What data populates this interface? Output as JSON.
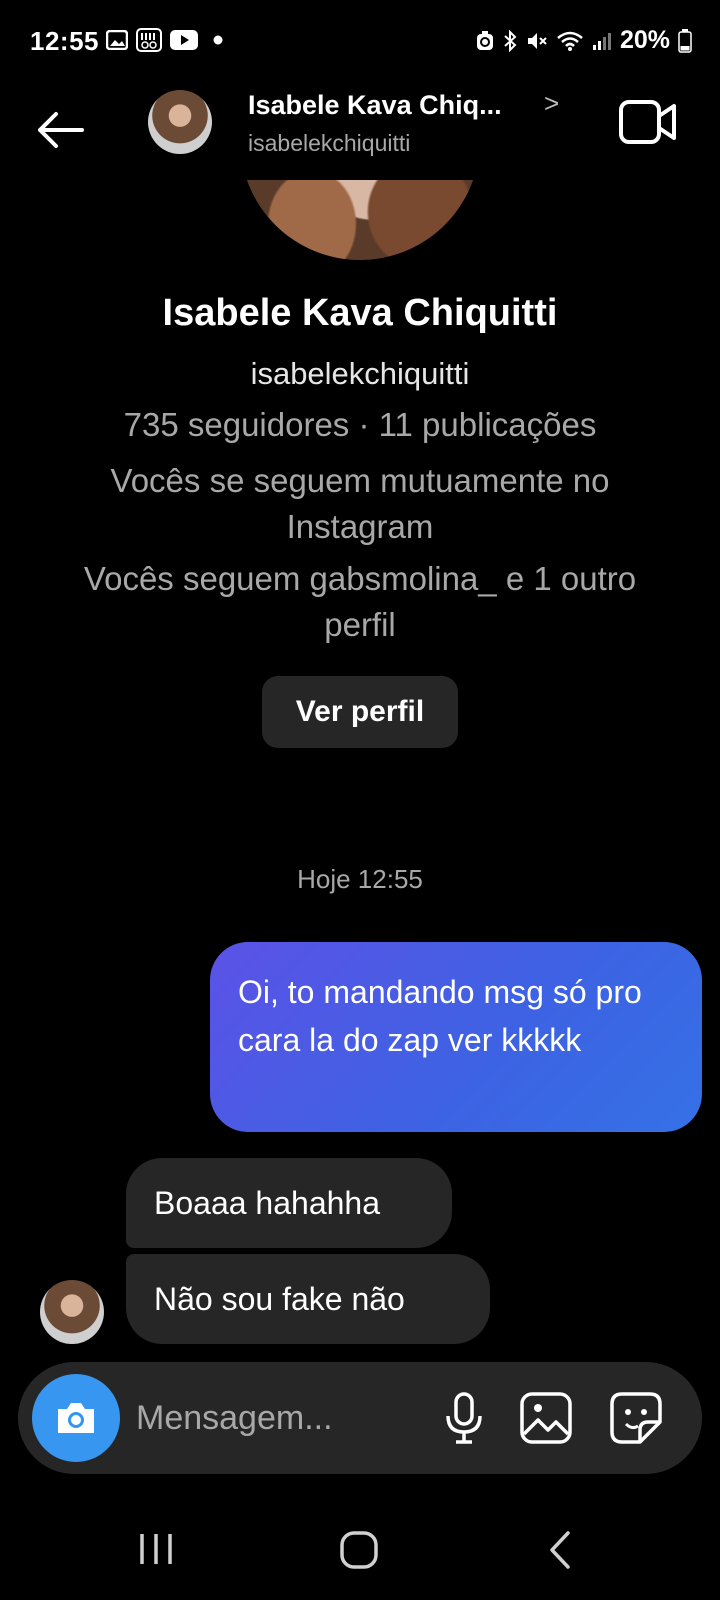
{
  "status_bar": {
    "time": "12:55",
    "battery": "20%",
    "icons": [
      "gallery-icon",
      "app-icon",
      "youtube-icon",
      "dot-icon",
      "alarm-icon",
      "bluetooth-icon",
      "mute-icon",
      "wifi-icon",
      "signal-icon",
      "battery-icon"
    ]
  },
  "header": {
    "name": "Isabele Kava Chiq...",
    "username": "isabelekchiquitti",
    "icons": [
      "back-arrow-icon",
      "chevron-right-icon",
      "video-call-icon"
    ]
  },
  "profile": {
    "name": "Isabele Kava Chiquitti",
    "username": "isabelekchiquitti",
    "stats": "735 seguidores · 11 publicações",
    "mutual": "Vocês se seguem mutuamente no Instagram",
    "followed_by": "Vocês seguem gabsmolina_ e 1 outro perfil",
    "view_profile_label": "Ver perfil"
  },
  "conversation": {
    "timestamp": "Hoje 12:55",
    "messages": [
      {
        "direction": "sent",
        "text": "Oi, to mandando msg só pro cara la do zap ver kkkkk"
      },
      {
        "direction": "received",
        "text": "Boaaa hahahha"
      },
      {
        "direction": "received",
        "text": "Não sou fake não"
      }
    ]
  },
  "composer": {
    "placeholder": "Mensagem...",
    "icons": [
      "camera-icon",
      "microphone-icon",
      "gallery-icon",
      "sticker-icon"
    ]
  },
  "colors": {
    "background": "#000000",
    "bubble_received": "#262626",
    "bubble_sent_start": "#5b52e6",
    "bubble_sent_end": "#3571e6",
    "camera_button": "#3797f0",
    "secondary_text": "#a8a8a8"
  }
}
